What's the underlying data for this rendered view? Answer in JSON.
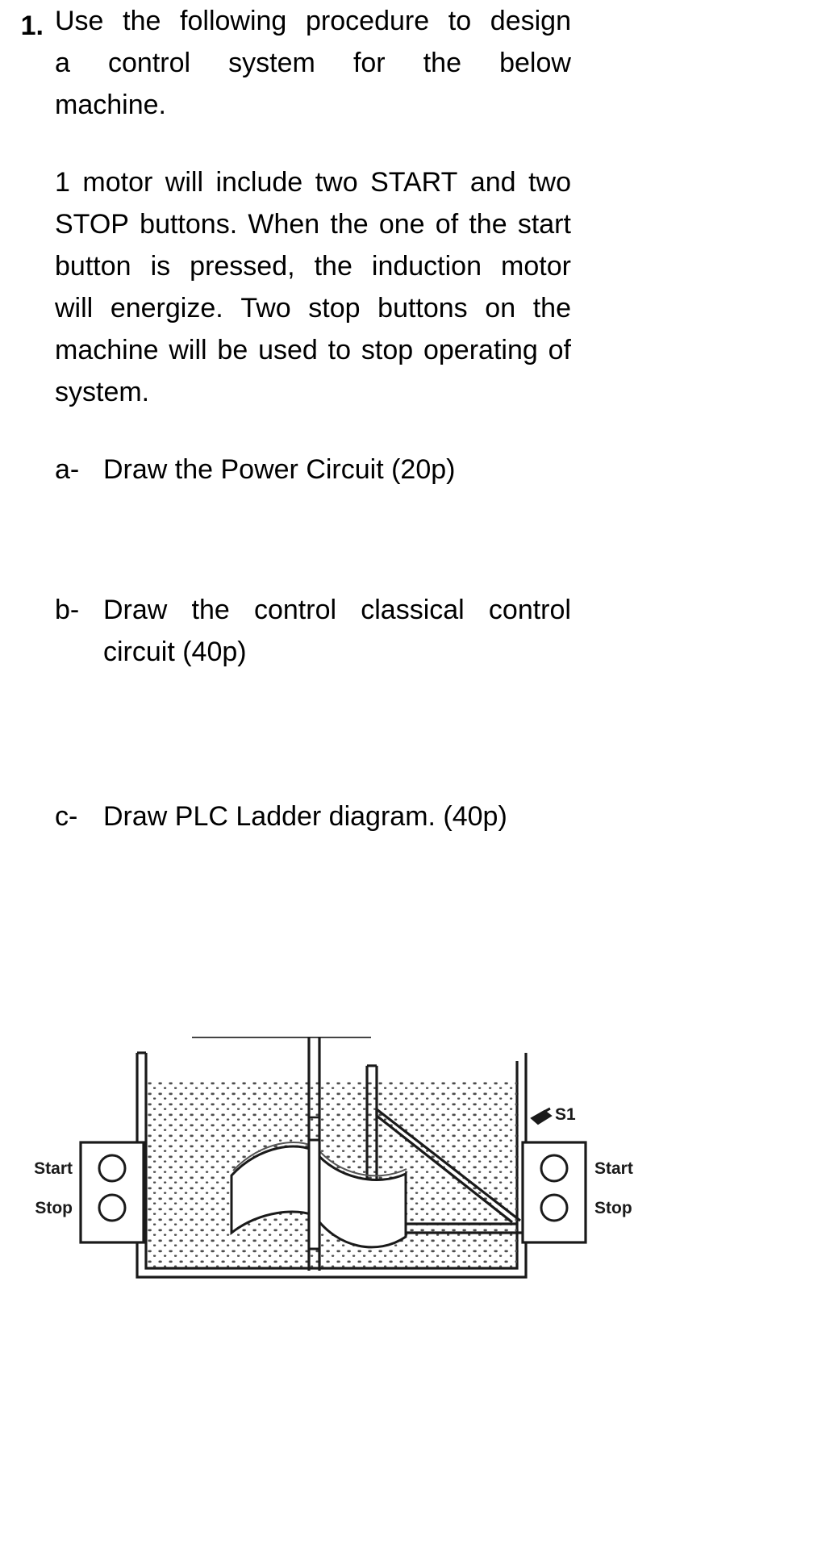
{
  "document": {
    "question_number": "1.",
    "prompt_lines": [
      [
        "Use",
        "the",
        "following",
        "procedure",
        "to",
        "design"
      ],
      [
        "a",
        "control",
        "system",
        "for",
        "the",
        "below"
      ],
      [
        "machine."
      ]
    ],
    "prompt_text": "Use the following procedure to design a control system for the below machine.",
    "description_lines": [
      [
        "1",
        "motor",
        "will",
        "include",
        "two",
        "START",
        "and",
        "two"
      ],
      [
        "STOP",
        "buttons.",
        "When",
        "the",
        "one",
        "of",
        "the",
        "start"
      ],
      [
        "button",
        "is",
        "pressed,",
        "the",
        "induction",
        "motor"
      ],
      [
        "will",
        "energize.",
        "",
        "Two",
        "stop",
        "buttons",
        "on",
        "the"
      ],
      [
        "machine",
        "will",
        "be",
        "used",
        "to",
        "stop",
        "operating",
        "of"
      ],
      [
        "system."
      ]
    ],
    "description_text": "1 motor will include two START and two STOP buttons. When the one of the start button is pressed, the induction motor will energize.  Two stop buttons on the machine will be used to stop operating of system.",
    "sub_items": [
      {
        "letter": "a-",
        "lines": [
          "Draw the Power Circuit (20p)"
        ],
        "text": "Draw the Power Circuit (20p)",
        "points": "20p"
      },
      {
        "letter": "b-",
        "lines": [
          [
            "Draw",
            "the",
            "control",
            "classical",
            "control"
          ],
          "circuit (40p)"
        ],
        "text": "Draw the control classical control circuit (40p)",
        "points": "40p"
      },
      {
        "letter": "c-",
        "lines": [
          "Draw PLC Ladder diagram. (40p)"
        ],
        "text": "Draw PLC Ladder diagram. (40p)",
        "points": "40p"
      }
    ]
  },
  "figure": {
    "caption": "",
    "sensor_label": "S1",
    "left_panel": {
      "buttons": [
        {
          "label": "Start",
          "name": "start"
        },
        {
          "label": "Stop",
          "name": "stop"
        }
      ]
    },
    "right_panel": {
      "buttons": [
        {
          "label": "Start",
          "name": "start"
        },
        {
          "label": "Stop",
          "name": "stop"
        }
      ]
    },
    "components": [
      "induction-motor",
      "motor-terminal-box",
      "mounting-bracket",
      "agitator-shaft",
      "impeller-blade",
      "mixing-tank",
      "liquid-fill",
      "proximity-sensor"
    ]
  },
  "colors": {
    "ink": "#000000",
    "line": "#1a1a1a",
    "paper": "#ffffff",
    "fill_dot": "#4d4d4d"
  }
}
